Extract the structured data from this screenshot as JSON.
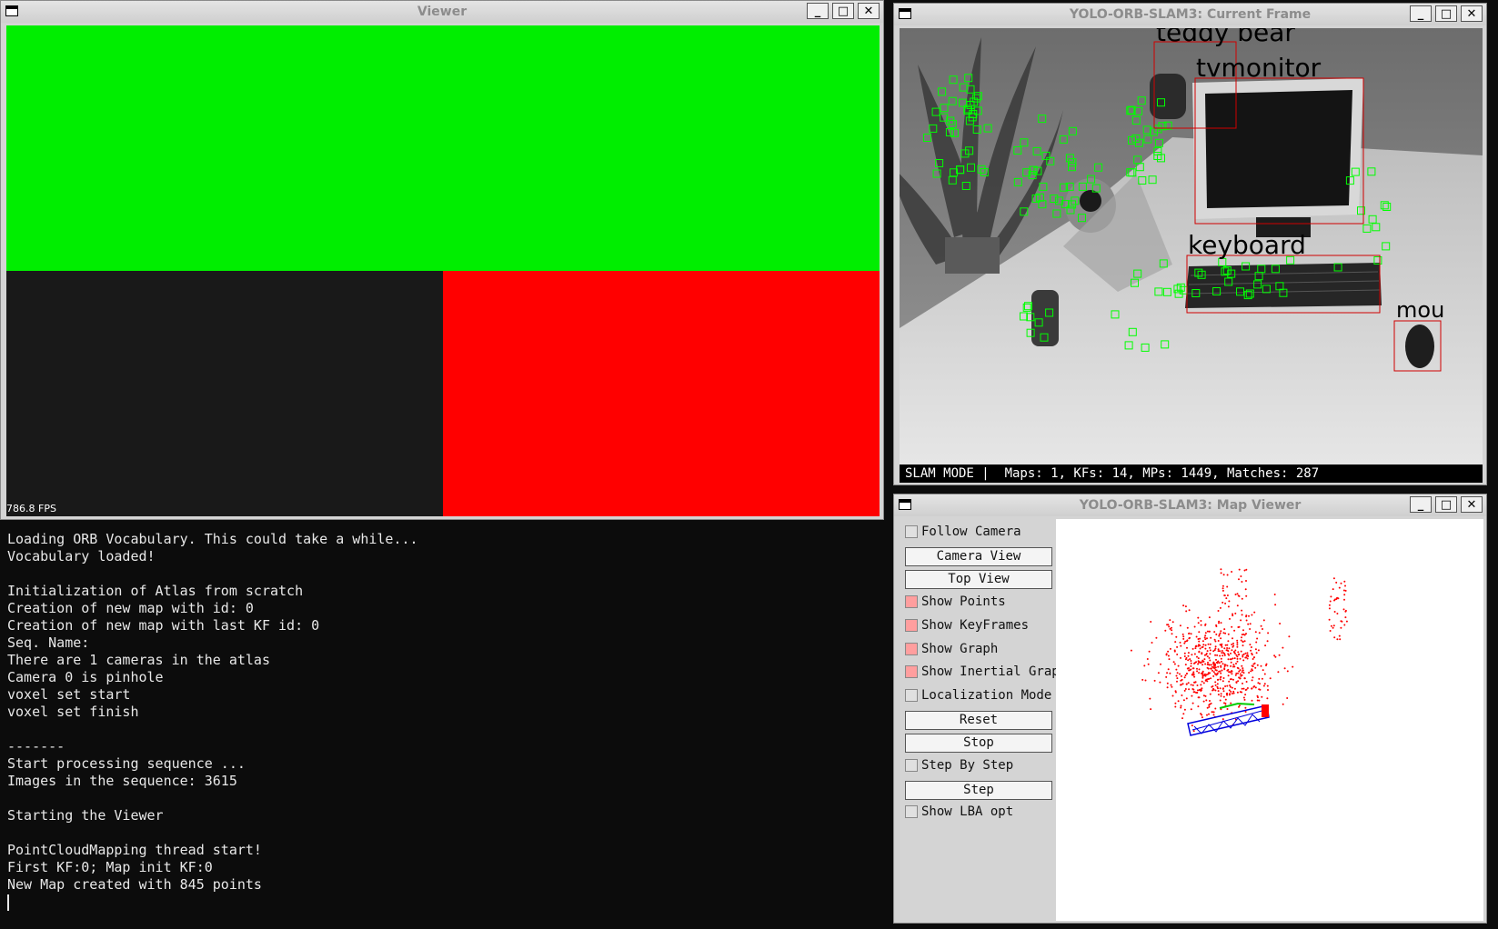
{
  "viewer": {
    "title": "Viewer",
    "fps": "786.8 FPS",
    "colors": {
      "top": "#00ee00",
      "bottom_left": "#191919",
      "bottom_right": "#ff0000"
    }
  },
  "terminal": {
    "lines": [
      "Loading ORB Vocabulary. This could take a while...",
      "Vocabulary loaded!",
      "",
      "Initialization of Atlas from scratch",
      "Creation of new map with id: 0",
      "Creation of new map with last KF id: 0",
      "Seq. Name:",
      "There are 1 cameras in the atlas",
      "Camera 0 is pinhole",
      "voxel set start",
      "voxel set finish",
      "",
      "-------",
      "Start processing sequence ...",
      "Images in the sequence: 3615",
      "",
      "Starting the Viewer",
      "",
      "PointCloudMapping thread start!",
      "First KF:0; Map init KF:0",
      "New Map created with 845 points"
    ]
  },
  "current_frame": {
    "title": "YOLO-ORB-SLAM3: Current Frame",
    "status": "SLAM MODE |  Maps: 1, KFs: 14, MPs: 1449, Matches: 287",
    "detections": [
      "teddy bear",
      "tvmonitor",
      "keyboard",
      "mou"
    ]
  },
  "map_viewer": {
    "title": "YOLO-ORB-SLAM3: Map Viewer",
    "panel": [
      {
        "type": "checkbox",
        "label": "Follow Camera",
        "checked": false
      },
      {
        "type": "button",
        "label": "Camera View"
      },
      {
        "type": "button",
        "label": "Top View"
      },
      {
        "type": "checkbox",
        "label": "Show Points",
        "checked": true
      },
      {
        "type": "checkbox",
        "label": "Show KeyFrames",
        "checked": true
      },
      {
        "type": "checkbox",
        "label": "Show Graph",
        "checked": true
      },
      {
        "type": "checkbox",
        "label": "Show Inertial Graph",
        "checked": true
      },
      {
        "type": "checkbox",
        "label": "Localization Mode",
        "checked": false
      },
      {
        "type": "button",
        "label": "Reset"
      },
      {
        "type": "button",
        "label": "Stop"
      },
      {
        "type": "checkbox",
        "label": "Step By Step",
        "checked": false
      },
      {
        "type": "button",
        "label": "Step"
      },
      {
        "type": "checkbox",
        "label": "Show LBA opt",
        "checked": false
      }
    ]
  },
  "window_buttons": {
    "minimize": "_",
    "maximize": "□",
    "close": "✕"
  }
}
